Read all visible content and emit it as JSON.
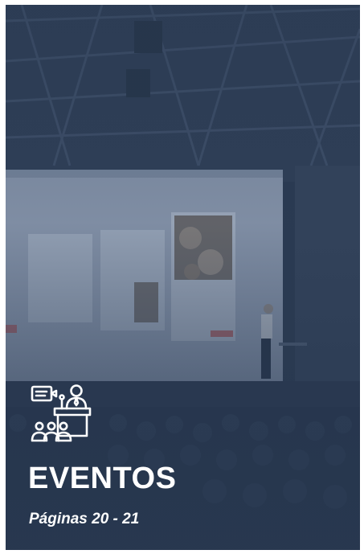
{
  "card": {
    "title": "EVENTOS",
    "subtitle": "Páginas 20 - 21"
  },
  "icons": {
    "presenter": "presenter-at-podium-icon"
  },
  "colors": {
    "overlay": "#2b3b52",
    "text": "#ffffff",
    "screen": "#8e9cb2"
  }
}
